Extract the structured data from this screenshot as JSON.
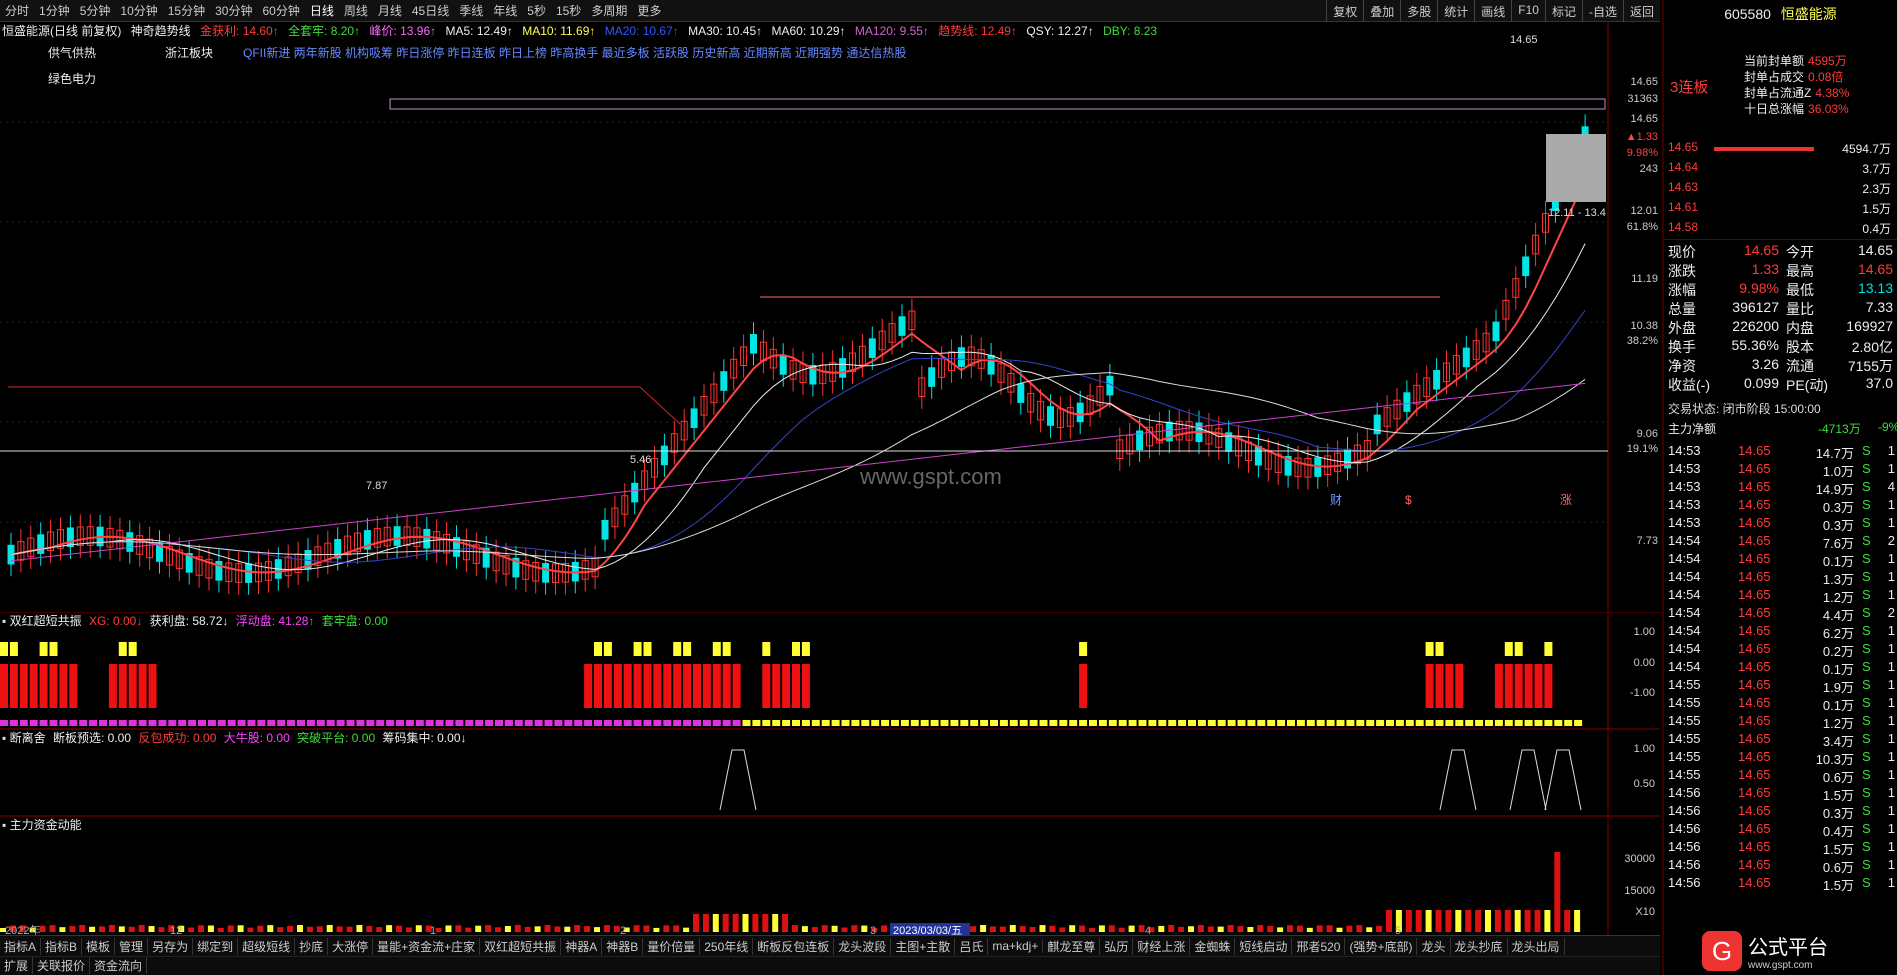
{
  "periods": [
    "分时",
    "1分钟",
    "5分钟",
    "10分钟",
    "15分钟",
    "30分钟",
    "60分钟",
    "日线",
    "周线",
    "月线",
    "45日线",
    "季线",
    "年线",
    "5秒",
    "15秒",
    "多周期",
    "更多"
  ],
  "active_period": "日线",
  "tools": [
    "复权",
    "叠加",
    "多股",
    "统计",
    "画线",
    "F10",
    "标记",
    "-自选",
    "返回"
  ],
  "stock": {
    "code": "605580",
    "name": "恒盛能源",
    "title": "恒盛能源(日线 前复权)",
    "indicator": "神奇趋势线"
  },
  "ma_line": {
    "a": "金获利: 14.60↑",
    "b": "全套牢: 8.20↑",
    "c": "峰价: 13.96↑",
    "d": "MA5: 12.49↑",
    "e": "MA10: 11.69↑",
    "f": "MA20: 10.67↑",
    "g": "MA30: 10.45↑",
    "h": "MA60: 10.29↑",
    "i": "MA120: 9.55↑",
    "j": "趋势线: 12.49↑",
    "k": "QSY: 12.27↑",
    "l": "DBY: 8.23"
  },
  "concepts": [
    "供气供热",
    "浙江板块",
    "绿色电力"
  ],
  "concept_tags": "QFII新进 两年新股 机构吸筹 昨日涨停 昨日连板 昨日上榜 昨高换手 最近多板 活跃股 历史新高 近期新高 近期强势 通达信热股",
  "price_axis": [
    "14.65",
    "31363",
    "14.65",
    "▲1.33",
    "9.98%",
    "243",
    "12.01",
    "61.8%",
    "11.19",
    "10.38",
    "38.2%",
    "9.06",
    "19.1%",
    "7.73"
  ],
  "low_label": "7.87",
  "high_label": "14.65",
  "range_label": "12.11 - 13.4",
  "mid_label": "5.46",
  "date_labels": [
    "2022年",
    "12",
    "1",
    "2",
    "3",
    "4",
    "5"
  ],
  "date_cursor": "2023/03/03/五",
  "markers": [
    "财",
    "$",
    "涨"
  ],
  "watermark": "www.gspt.com",
  "pane2": {
    "title": "双红超短共振",
    "items": [
      "XG: 0.00↓",
      "获利盘: 58.72↓",
      "浮动盘: 41.28↑",
      "套牢盘: 0.00"
    ],
    "axis": [
      "1.00",
      "0.00",
      "-1.00"
    ]
  },
  "pane3": {
    "title": "断离舍",
    "items": [
      "断板预选: 0.00",
      "反包成功: 0.00",
      "大牛股: 0.00",
      "突破平台: 0.00",
      "筹码集中: 0.00↓"
    ],
    "axis": [
      "1.00",
      "0.50"
    ]
  },
  "pane4": {
    "title": "主力资金动能",
    "axis": [
      "30000",
      "15000",
      "X10"
    ]
  },
  "side": {
    "seal_title": "3连板",
    "seal": [
      {
        "k": "当前封单额",
        "v": "4595万"
      },
      {
        "k": "封单占成交",
        "v": "0.08倍"
      },
      {
        "k": "封单占流通Z",
        "v": "4.38%"
      },
      {
        "k": "十日总涨幅",
        "v": "36.03%"
      }
    ],
    "asks": [
      {
        "p": "14.65",
        "v": "4594.7万"
      },
      {
        "p": "14.64",
        "v": "3.7万"
      },
      {
        "p": "14.63",
        "v": "2.3万"
      },
      {
        "p": "14.61",
        "v": "1.5万"
      },
      {
        "p": "14.58",
        "v": "0.4万"
      }
    ],
    "quote": [
      [
        "现价",
        "14.65",
        "今开",
        "14.65"
      ],
      [
        "涨跌",
        "1.33",
        "最高",
        "14.65"
      ],
      [
        "涨幅",
        "9.98%",
        "最低",
        "13.13"
      ],
      [
        "总量",
        "396127",
        "量比",
        "7.33"
      ],
      [
        "外盘",
        "226200",
        "内盘",
        "169927"
      ],
      [
        "换手",
        "55.36%",
        "股本",
        "2.80亿"
      ],
      [
        "净资",
        "3.26",
        "流通",
        "7155万"
      ],
      [
        "收益(-)",
        "0.099",
        "PE(动)",
        "37.0"
      ]
    ],
    "trade_state": "交易状态: 闭市阶段 15:00:00",
    "net_label": "主力净额",
    "net_val": "-4713万",
    "net_pct": "-9%",
    "ticks": [
      [
        "14:53",
        "14.65",
        "14.7万",
        "S",
        "1"
      ],
      [
        "14:53",
        "14.65",
        "1.0万",
        "S",
        "1"
      ],
      [
        "14:53",
        "14.65",
        "14.9万",
        "S",
        "4"
      ],
      [
        "14:53",
        "14.65",
        "0.3万",
        "S",
        "1"
      ],
      [
        "14:53",
        "14.65",
        "0.3万",
        "S",
        "1"
      ],
      [
        "14:54",
        "14.65",
        "7.6万",
        "S",
        "2"
      ],
      [
        "14:54",
        "14.65",
        "0.1万",
        "S",
        "1"
      ],
      [
        "14:54",
        "14.65",
        "1.3万",
        "S",
        "1"
      ],
      [
        "14:54",
        "14.65",
        "1.2万",
        "S",
        "1"
      ],
      [
        "14:54",
        "14.65",
        "4.4万",
        "S",
        "2"
      ],
      [
        "14:54",
        "14.65",
        "6.2万",
        "S",
        "1"
      ],
      [
        "14:54",
        "14.65",
        "0.2万",
        "S",
        "1"
      ],
      [
        "14:54",
        "14.65",
        "0.1万",
        "S",
        "1"
      ],
      [
        "14:55",
        "14.65",
        "1.9万",
        "S",
        "1"
      ],
      [
        "14:55",
        "14.65",
        "0.1万",
        "S",
        "1"
      ],
      [
        "14:55",
        "14.65",
        "1.2万",
        "S",
        "1"
      ],
      [
        "14:55",
        "14.65",
        "3.4万",
        "S",
        "1"
      ],
      [
        "14:55",
        "14.65",
        "10.3万",
        "S",
        "1"
      ],
      [
        "14:55",
        "14.65",
        "0.6万",
        "S",
        "1"
      ],
      [
        "14:56",
        "14.65",
        "1.5万",
        "S",
        "1"
      ],
      [
        "14:56",
        "14.65",
        "0.3万",
        "S",
        "1"
      ],
      [
        "14:56",
        "14.65",
        "0.4万",
        "S",
        "1"
      ],
      [
        "14:56",
        "14.65",
        "1.5万",
        "S",
        "1"
      ],
      [
        "14:56",
        "14.65",
        "0.6万",
        "S",
        "1"
      ],
      [
        "14:56",
        "14.65",
        "1.5万",
        "S",
        "1"
      ]
    ]
  },
  "bottom_tabs": [
    "指标A",
    "指标B",
    "模板",
    "管理",
    "另存为",
    "绑定到",
    "超级短线",
    "抄底",
    "大涨停",
    "量能+资金流+庄家",
    "双红超短共振",
    "神器A",
    "神器B",
    "量价倍量",
    "250年线",
    "断板反包连板",
    "龙头波段",
    "主图+主散",
    "吕氏",
    "ma+kdj+",
    "麒龙至尊",
    "弘历",
    "财经上涨",
    "金蜘蛛",
    "短线启动",
    "邢者520",
    "(强势+底部)",
    "龙头",
    "龙头抄底",
    "龙头出局"
  ],
  "bottom_tabs2": [
    "扩展",
    "关联报价",
    "资金流向"
  ],
  "logo_text": "公式平台",
  "logo_url": "www.gspt.com",
  "day_label": "日线"
}
